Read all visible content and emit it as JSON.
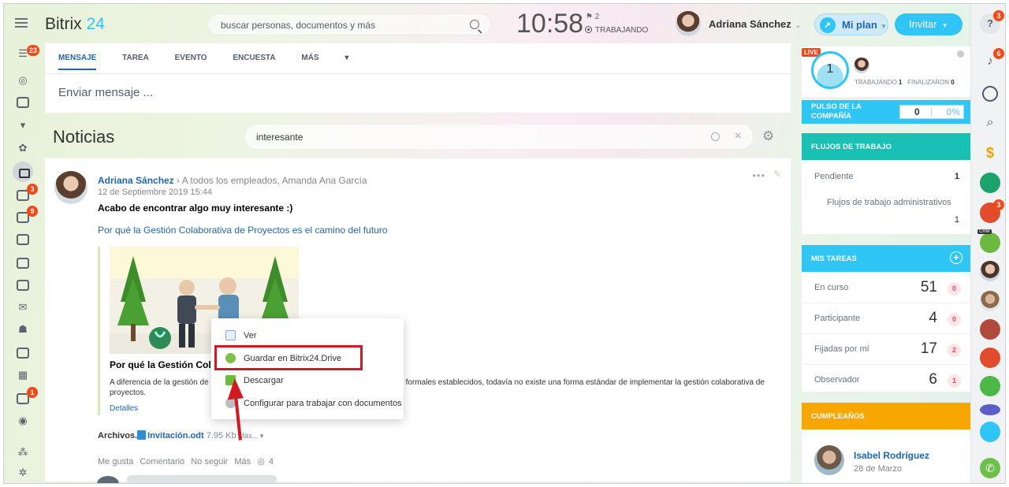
{
  "header": {
    "app_name": "Bitrix",
    "app_number": "24",
    "search_placeholder": "buscar personas, documentos y más",
    "time": "10:58",
    "flag_count": "2",
    "work_status": "TRABAJANDO",
    "user_name": "Adriana Sánchez",
    "plan_label": "Mi plan",
    "invite_label": "Invitar"
  },
  "leftnav": {
    "badges": [
      "23",
      "3",
      "9",
      "1"
    ]
  },
  "composer": {
    "tabs": [
      "MENSAJE",
      "TAREA",
      "EVENTO",
      "ENCUESTA",
      "MÁS"
    ],
    "placeholder": "Enviar mensaje ..."
  },
  "feed": {
    "title": "Noticias",
    "filter_value": "interesante"
  },
  "post": {
    "author": "Adriana Sánchez",
    "recipients": "A todos los empleados, Amanda Ana García",
    "date": "12 de Septiembre 2019 15:44",
    "title": "Acabo de encontrar algo muy interesante :)",
    "link": "Por qué la Gestión Colaborativa de Proyectos es el camino del futuro",
    "quote_title": "Por qué la Gestión Colab",
    "quote_text_1": "A diferencia de la gestión de",
    "quote_text_2": "formales establecidos, todavía no existe una forma estándar de implementar la gestión colaborativa de",
    "quote_text_3": "proyectos.",
    "details": "Detalles",
    "files_label": "Archivos.",
    "file_name": "Invitación.odt",
    "file_size": "7.95 Kb",
    "more": "Más...",
    "actions": [
      "Me gusta",
      "Comentario",
      "No seguir",
      "Más"
    ],
    "views": "4"
  },
  "context_menu": {
    "items": [
      "Ver",
      "Guardar en Bitrix24.Drive",
      "Descargar",
      "Configurar para trabajar con documentos"
    ]
  },
  "right_panel": {
    "live_label": "LIVE",
    "counter": "1",
    "working_label": "TRABAJANDO",
    "working_value": "1",
    "finished_label": "FINALIZARON",
    "finished_value": "0",
    "pulse_title": "PULSO DE LA COMPAÑÍA",
    "pulse_value": "0",
    "pulse_percent": "0%",
    "workflows_title": "FLUJOS DE TRABAJO",
    "pending_label": "Pendiente",
    "pending_value": "1",
    "admin_workflows_label": "Flujos de trabajo administrativos",
    "admin_workflows_value": "1",
    "tasks_title": "MIS TAREAS",
    "tasks": [
      {
        "label": "En curso",
        "value": "51",
        "count": "0"
      },
      {
        "label": "Participante",
        "value": "4",
        "count": "0"
      },
      {
        "label": "Fijadas por mí",
        "value": "17",
        "count": "2"
      },
      {
        "label": "Observador",
        "value": "6",
        "count": "1"
      }
    ],
    "birthdays_title": "CUMPLEAÑOS",
    "birthday_name": "Isabel Rodríguez",
    "birthday_date": "28 de Marzo"
  },
  "right_sidebar": {
    "help_badge": "3",
    "notif_badge": "6",
    "crm_badge": "3",
    "crm_label": "CRM"
  },
  "colors": {
    "accent": "#2fc6f6",
    "link": "#2067b0",
    "badge": "#f54819",
    "birthday": "#f7a700",
    "workflows": "#19c1b5",
    "highlight": "#d2191f"
  }
}
